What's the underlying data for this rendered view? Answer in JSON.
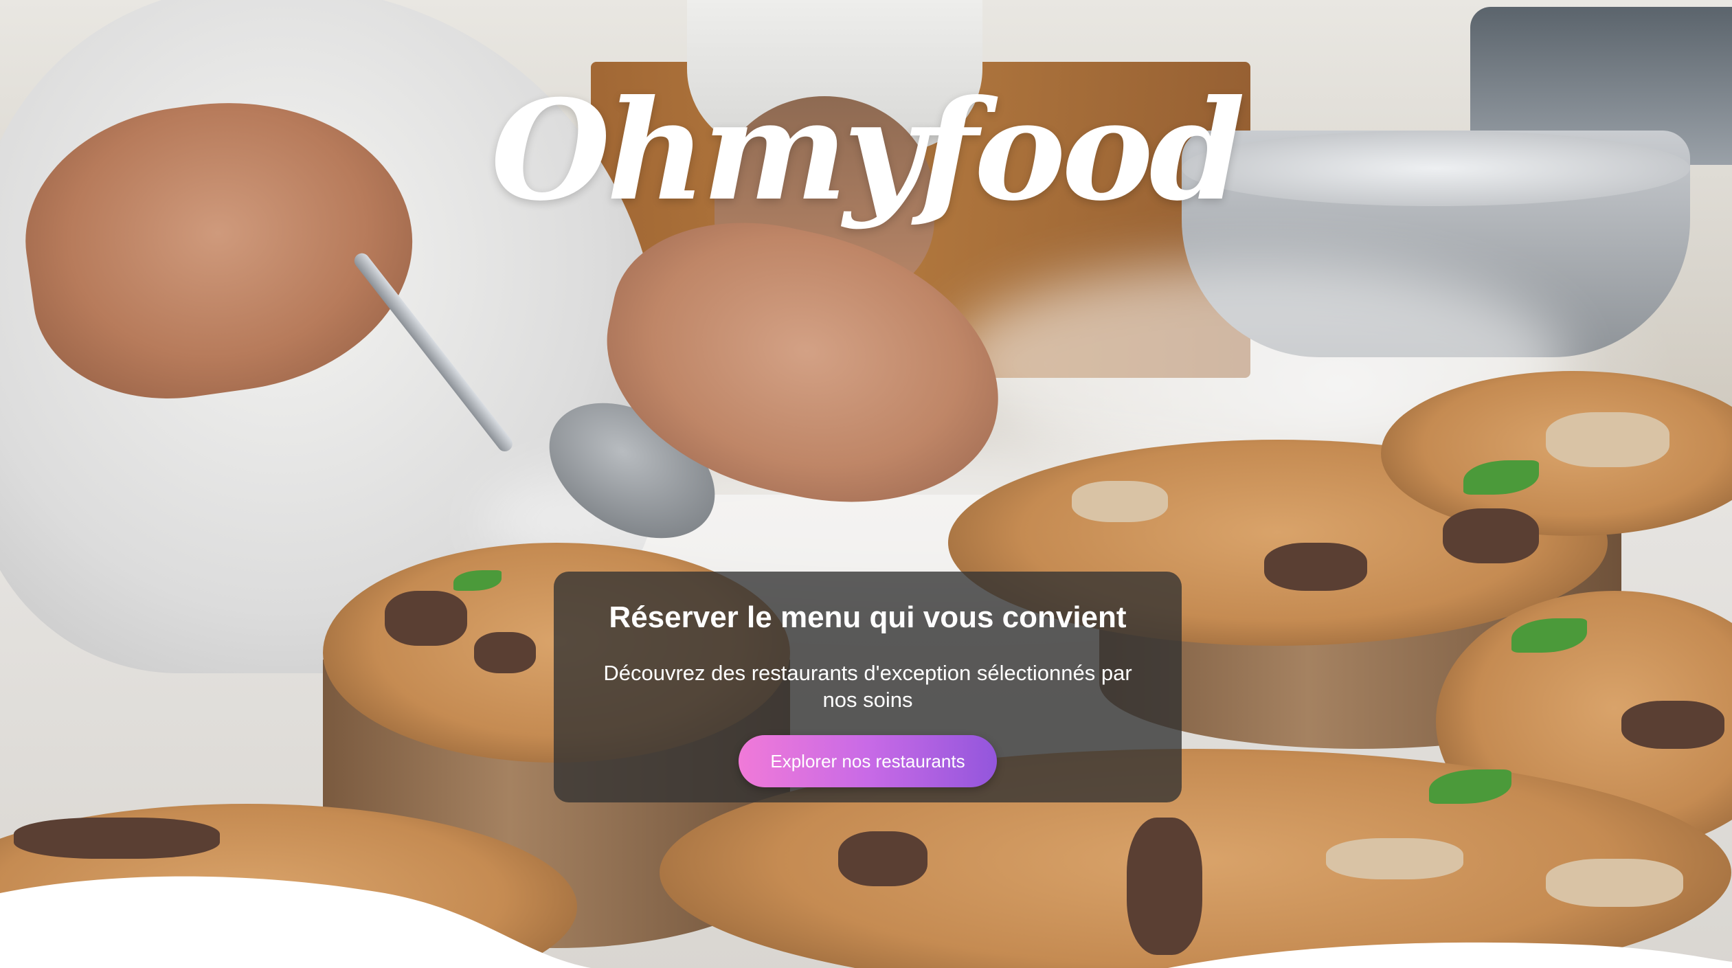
{
  "brand": {
    "logo_text": "Ohmyfood"
  },
  "hero": {
    "title": "Réserver le menu qui vous convient",
    "subtitle": "Découvrez des restaurants d'exception sélectionnés par nos soins",
    "cta_label": "Explorer nos restaurants"
  },
  "colors": {
    "cta_gradient_start": "#f07ad8",
    "cta_gradient_end": "#9356dc",
    "card_background": "rgba(50,50,50,0.78)"
  }
}
